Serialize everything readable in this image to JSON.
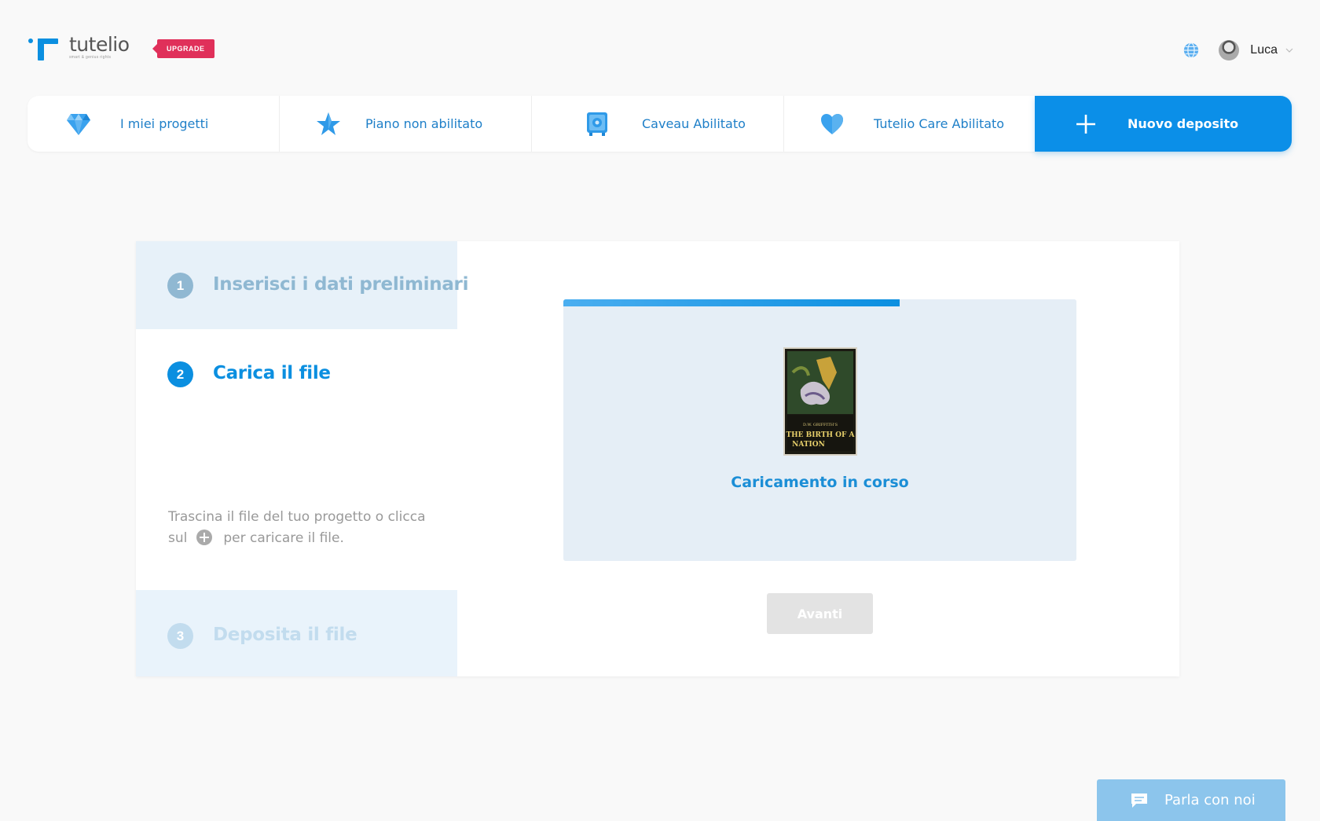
{
  "brand": {
    "name": "tutelio",
    "tagline": "smart & genius rights",
    "upgrade_label": "UPGRADE",
    "accent": "#0b8fe0",
    "upgrade_color": "#e0305a"
  },
  "header": {
    "language_icon": "globe-icon",
    "user_name": "Luca"
  },
  "nav": {
    "tabs": [
      {
        "label": "I miei progetti",
        "icon": "diamond-icon"
      },
      {
        "label": "Piano non abilitato",
        "icon": "star-icon"
      },
      {
        "label": "Caveau Abilitato",
        "icon": "safe-icon"
      },
      {
        "label": "Tutelio Care Abilitato",
        "icon": "heart-icon"
      }
    ],
    "new_deposit_label": "Nuovo deposito"
  },
  "wizard": {
    "steps": [
      {
        "number": "1",
        "title": "Inserisci i dati preliminari",
        "state": "done"
      },
      {
        "number": "2",
        "title": "Carica il file",
        "state": "active"
      },
      {
        "number": "3",
        "title": "Deposita il file",
        "state": "pending"
      }
    ],
    "hint_before": "Trascina il file del tuo progetto o clicca sul",
    "hint_after": "per caricare il file.",
    "upload": {
      "progress": 0.655,
      "status": "Caricamento in corso",
      "thumbnail_lines": [
        "D.W. GRIFFITH'S",
        "THE BIRTH OF A",
        "NATION"
      ]
    },
    "next_label": "Avanti"
  },
  "chat": {
    "label": "Parla con noi"
  }
}
